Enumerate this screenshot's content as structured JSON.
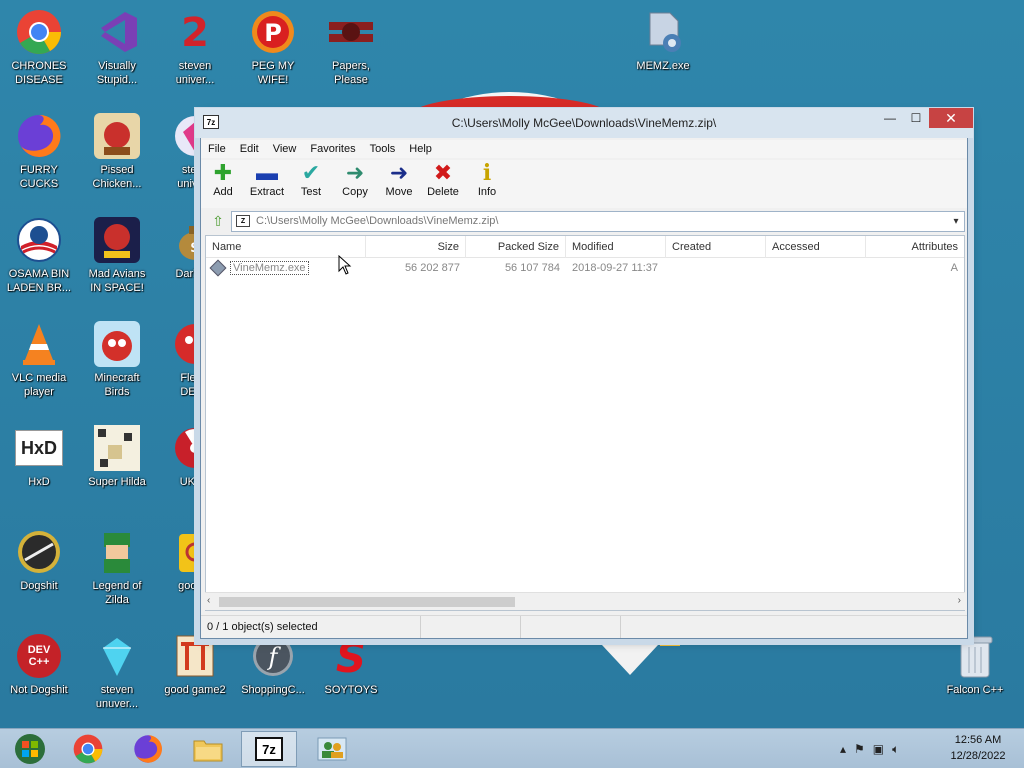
{
  "desktop": {
    "icons": [
      {
        "label": "CHRONES\nDISEASE",
        "icon": "chrome-icon"
      },
      {
        "label": "Visually\nStupid...",
        "icon": "visual-studio-icon"
      },
      {
        "label": "steven\nuniver...",
        "icon": "steven-universe-icon"
      },
      {
        "label": "PEG MY WIFE!",
        "icon": "peggle-icon"
      },
      {
        "label": "Papers,\nPlease",
        "icon": "papers-please-icon"
      },
      {
        "label": "MEMZ.exe",
        "icon": "memz-icon"
      },
      {
        "label": "FURRY CUCKS",
        "icon": "firefox-icon"
      },
      {
        "label": "Pissed\nChicken...",
        "icon": "angry-birds-seasons-icon"
      },
      {
        "label": "steve\nunive...",
        "icon": "steven-universe-gem-icon"
      },
      {
        "label": "OSAMA BIN\nLADEN BR...",
        "icon": "obama-logo-icon"
      },
      {
        "label": "Mad Avians\nIN SPACE!",
        "icon": "angry-birds-space-icon"
      },
      {
        "label": "DarkOK",
        "icon": "money-bag-icon"
      },
      {
        "label": "VLC media\nplayer",
        "icon": "vlc-icon"
      },
      {
        "label": "Minecraft\nBirds",
        "icon": "angry-birds-icon"
      },
      {
        "label": "Fleshi\nDELU",
        "icon": "flesh-icon"
      },
      {
        "label": "HxD",
        "icon": "hxd-icon"
      },
      {
        "label": "Super Hilda",
        "icon": "pixel-art-icon"
      },
      {
        "label": "UKRA",
        "icon": "radiation-icon"
      },
      {
        "label": "Dogshit",
        "icon": "dogshit-icon"
      },
      {
        "label": "Legend of\nZilda",
        "icon": "zelda-icon"
      },
      {
        "label": "good g",
        "icon": "mahjong-icon"
      },
      {
        "label": "Not Dogshit",
        "icon": "dev-cpp-icon"
      },
      {
        "label": "steven\nunuver...",
        "icon": "diamond-icon"
      },
      {
        "label": "good game2",
        "icon": "torii-icon"
      },
      {
        "label": "ShoppingC...",
        "icon": "flash-icon"
      },
      {
        "label": "SOYTOYS",
        "icon": "soytoys-icon"
      },
      {
        "label": "Falcon C++",
        "icon": "recycle-bin-icon"
      }
    ],
    "dev_text": "DEV\nC++",
    "hxd_text": "HxD",
    "chrome_colors": [
      "#ea4335",
      "#fbbc05",
      "#34a853",
      "#4285f4"
    ]
  },
  "window": {
    "title": "C:\\Users\\Molly McGee\\Downloads\\VineMemz.zip\\",
    "app_icon_text": "7z",
    "menu": [
      "File",
      "Edit",
      "View",
      "Favorites",
      "Tools",
      "Help"
    ],
    "toolbar": [
      {
        "label": "Add",
        "icon": "plus-icon",
        "glyph": "✚",
        "color": "#2fa32f"
      },
      {
        "label": "Extract",
        "icon": "minus-icon",
        "glyph": "▬",
        "color": "#1a3fb0"
      },
      {
        "label": "Test",
        "icon": "checkmark-icon",
        "glyph": "✔",
        "color": "#2aa8a0"
      },
      {
        "label": "Copy",
        "icon": "copy-arrow-icon",
        "glyph": "➜",
        "color": "#2e8b6e"
      },
      {
        "label": "Move",
        "icon": "move-arrow-icon",
        "glyph": "➜",
        "color": "#1b2e8a"
      },
      {
        "label": "Delete",
        "icon": "delete-x-icon",
        "glyph": "✖",
        "color": "#d11a1a"
      },
      {
        "label": "Info",
        "icon": "info-icon",
        "glyph": "i",
        "color": "#c8a400"
      }
    ],
    "address": "C:\\Users\\Molly McGee\\Downloads\\VineMemz.zip\\",
    "address_icon_text": "Z",
    "columns": [
      "Name",
      "Size",
      "Packed Size",
      "Modified",
      "Created",
      "Accessed",
      "Attributes"
    ],
    "rows": [
      {
        "name": "VineMemz.exe",
        "size": "56 202 877",
        "packed": "56 107 784",
        "modified": "2018-09-27 11:37",
        "created": "",
        "accessed": "",
        "attributes": "A"
      }
    ],
    "status": [
      "0 / 1 object(s) selected",
      "",
      "",
      ""
    ]
  },
  "taskbar": {
    "buttons": [
      {
        "name": "start-button",
        "icon": "start-orb-icon"
      },
      {
        "name": "chrome-task",
        "icon": "chrome-icon"
      },
      {
        "name": "firefox-task",
        "icon": "firefox-icon"
      },
      {
        "name": "explorer-task",
        "icon": "folder-icon"
      },
      {
        "name": "7zip-task",
        "icon": "7zip-icon",
        "text": "7z"
      },
      {
        "name": "network-task",
        "icon": "people-icon"
      }
    ],
    "time": "12:56 AM",
    "date": "12/28/2022"
  }
}
